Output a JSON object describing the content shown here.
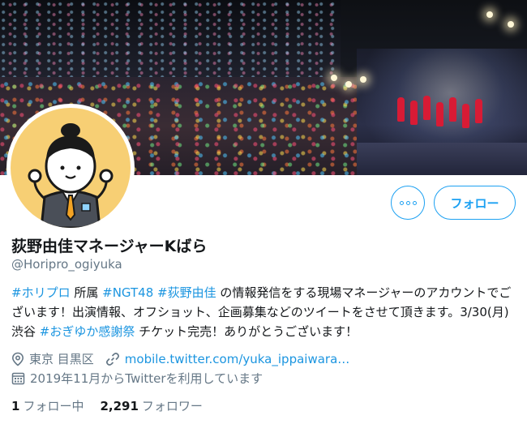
{
  "profile": {
    "display_name": "荻野由佳マネージャーKばら",
    "handle": "@Horipro_ogiyuka",
    "more_button_icon": "more-icon",
    "follow_label": "フォロー"
  },
  "bio": {
    "tag1": "#ホリプロ",
    "text1": " 所属 ",
    "tag2": "#NGT48",
    "text2": " ",
    "tag3": "#荻野由佳",
    "text3": " の情報発信をする現場マネージャーのアカウントでございます！出演情報、オフショット、企画募集などのツイートをさせて頂きます。3/30(月)渋谷 ",
    "tag4": "#おぎゆか感謝祭",
    "text4": " チケット完売！ありがとうございます！"
  },
  "meta": {
    "location": "東京 目黒区",
    "url": "mobile.twitter.com/yuka_ippaiwara…",
    "joined": "2019年11月からTwitterを利用しています",
    "location_icon": "location-pin-icon",
    "link_icon": "link-icon",
    "calendar_icon": "calendar-icon"
  },
  "stats": {
    "following_count": "1",
    "following_label": "フォロー中",
    "followers_count": "2,291",
    "followers_label": "フォロワー"
  },
  "colors": {
    "accent": "#1da1f2",
    "link": "#1b95e0",
    "secondary_text": "#657786",
    "avatar_bg": "#f7cf74"
  }
}
